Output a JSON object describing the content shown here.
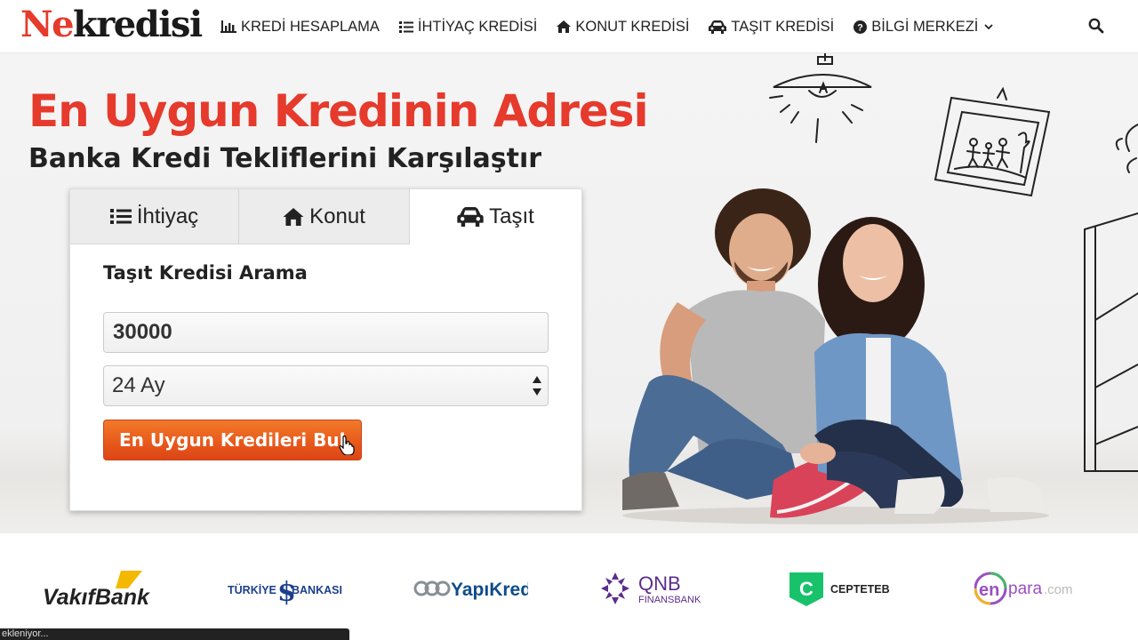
{
  "header": {
    "logo_red": "Ne",
    "logo_dark": "kredisi",
    "nav": [
      {
        "label": "KREDİ HESAPLAMA",
        "icon": "bar-chart-icon"
      },
      {
        "label": "İHTİYAÇ KREDİSİ",
        "icon": "list-icon"
      },
      {
        "label": "KONUT KREDİSİ",
        "icon": "home-icon"
      },
      {
        "label": "TAŞIT KREDİSİ",
        "icon": "car-icon"
      },
      {
        "label": "BİLGİ MERKEZİ",
        "icon": "question-circle-icon"
      }
    ],
    "search_icon": "search-icon"
  },
  "hero": {
    "title": "En Uygun Kredinin Adresi",
    "subtitle": "Banka Kredi Tekliflerini Karşılaştır"
  },
  "form": {
    "tabs": [
      {
        "label": "İhtiyaç",
        "icon": "list-icon"
      },
      {
        "label": "Konut",
        "icon": "home-icon"
      },
      {
        "label": "Taşıt",
        "icon": "car-icon",
        "active": true
      }
    ],
    "title": "Taşıt Kredisi Arama",
    "amount_value": "30000",
    "term_value": "24 Ay",
    "submit_label": "En Uygun Kredileri Bul"
  },
  "banks": [
    "VakıfBank",
    "TÜRKİYE",
    "BANKASI",
    "YapıKredi",
    "QNB",
    "FINANSBANK",
    "CEPTETEB",
    "en",
    "para",
    ".com"
  ],
  "status_bar": "ekleniyor...",
  "colors": {
    "brand_red": "#e53a2c",
    "cta_orange": "#e85a1c",
    "text_dark": "#222222"
  }
}
